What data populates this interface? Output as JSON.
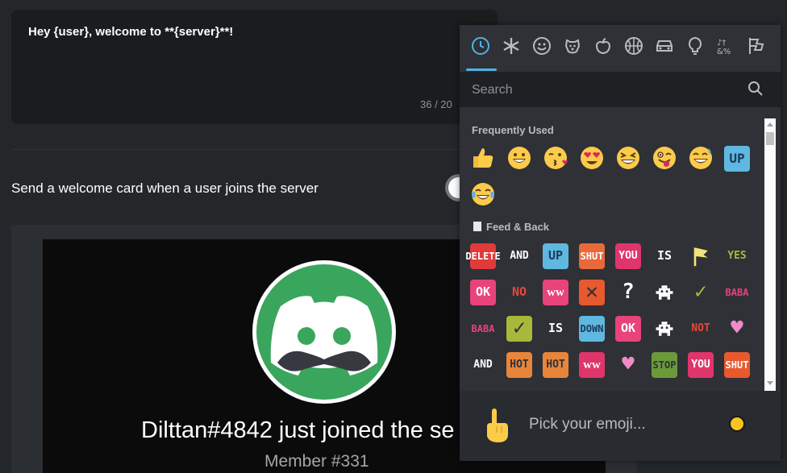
{
  "welcome_message": {
    "text": "Hey {user}, welcome to **{server}**!",
    "counter": "36 / 20"
  },
  "welcome_card_toggle": {
    "label": "Send a welcome card when a user joins the server"
  },
  "card_preview": {
    "title": "Dilttan#4842 just joined the se",
    "subtitle": "Member #331"
  },
  "emoji_picker": {
    "categories": [
      "recent-icon",
      "asterisk-icon",
      "smiley-icon",
      "dog-icon",
      "apple-icon",
      "basketball-icon",
      "car-icon",
      "lightbulb-icon",
      "symbols-icon",
      "flags-icon"
    ],
    "selected_category": "recent-icon",
    "search_placeholder": "Search",
    "sections": [
      {
        "title": "Frequently Used",
        "items": [
          "thumbs-up",
          "grinning",
          "kissing-heart",
          "heart-eyes",
          "laughing",
          "winking-tongue",
          "sweat-smile",
          "up-sticker",
          "joy"
        ]
      },
      {
        "title": "Feed & Back",
        "items": [
          {
            "text": "DEL ETE",
            "color": "#e03a3a",
            "fg": "#ffffff"
          },
          {
            "text": "AND",
            "color": "transparent",
            "fg": "#ffffff"
          },
          {
            "text": "UP",
            "color": "#5fb8e0",
            "fg": "#1a3a5a"
          },
          {
            "text": "SH UT",
            "color": "#e86a3a",
            "fg": "#ffffff"
          },
          {
            "text": "YOU",
            "color": "#e0356a",
            "fg": "#ffffff"
          },
          {
            "text": "IS",
            "color": "transparent",
            "fg": "#ffffff"
          },
          {
            "text": "flag",
            "color": "transparent",
            "fg": "#f2e37a"
          },
          {
            "text": "YES",
            "color": "transparent",
            "fg": "#a8b83a"
          },
          {
            "text": "OK",
            "color": "#e8437a",
            "fg": "#ffffff"
          },
          {
            "text": "NO",
            "color": "transparent",
            "fg": "#e8463a"
          },
          {
            "text": "ᴡᴡ",
            "color": "#e8437a",
            "fg": "#ffffff"
          },
          {
            "text": "✕",
            "color": "#e8592e",
            "fg": "#2f3136"
          },
          {
            "text": "?",
            "color": "transparent",
            "fg": "#ffffff"
          },
          {
            "text": "bug",
            "color": "transparent",
            "fg": "#ffffff"
          },
          {
            "text": "✓",
            "color": "transparent",
            "fg": "#a8b83a"
          },
          {
            "text": "BA BA",
            "color": "transparent",
            "fg": "#e8437a"
          },
          {
            "text": "BA BA",
            "color": "transparent",
            "fg": "#e8437a"
          },
          {
            "text": "✓",
            "color": "#a8b83a",
            "fg": "#2f3136"
          },
          {
            "text": "IS",
            "color": "transparent",
            "fg": "#ffffff"
          },
          {
            "text": "DO WN",
            "color": "#5fb8e0",
            "fg": "#1a3a5a"
          },
          {
            "text": "OK",
            "color": "#e8437a",
            "fg": "#ffffff"
          },
          {
            "text": "bug",
            "color": "transparent",
            "fg": "#ffffff"
          },
          {
            "text": "NOT",
            "color": "transparent",
            "fg": "#e8463a"
          },
          {
            "text": "♥",
            "color": "transparent",
            "fg": "#f08ac8"
          },
          {
            "text": "AND",
            "color": "transparent",
            "fg": "#ffffff"
          },
          {
            "text": "HOT",
            "color": "#e8853a",
            "fg": "#2f3136"
          },
          {
            "text": "HOT",
            "color": "#e8853a",
            "fg": "#2f3136"
          },
          {
            "text": "ᴡᴡ",
            "color": "#e0356a",
            "fg": "#ffffff"
          },
          {
            "text": "♥",
            "color": "transparent",
            "fg": "#f08ac8"
          },
          {
            "text": "ST OP",
            "color": "#6a9a3a",
            "fg": "#2f3136"
          },
          {
            "text": "YOU",
            "color": "#e0356a",
            "fg": "#ffffff"
          },
          {
            "text": "SH UT",
            "color": "#e8592e",
            "fg": "#ffffff"
          }
        ]
      }
    ],
    "footer_text": "Pick your emoji...",
    "accent_color": "#4fb3e6"
  }
}
